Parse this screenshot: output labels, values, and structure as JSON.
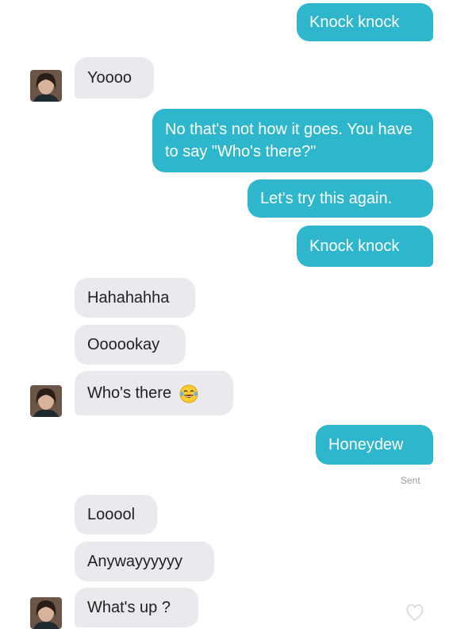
{
  "conversation": {
    "messages": [
      {
        "from": "me",
        "text": "Knock knock"
      },
      {
        "from": "them",
        "text": "Yoooo"
      },
      {
        "from": "me",
        "text": "No that's not how it goes. You have to say \"Who's there?\""
      },
      {
        "from": "me",
        "text": "Let's try this again."
      },
      {
        "from": "me",
        "text": "Knock knock"
      },
      {
        "from": "them",
        "text": "Hahahahha"
      },
      {
        "from": "them",
        "text": "Oooookay"
      },
      {
        "from": "them",
        "text": "Who's there",
        "emoji": "tears-of-joy-emoji"
      },
      {
        "from": "me",
        "text": "Honeydew"
      },
      {
        "from": "them",
        "text": "Looool"
      },
      {
        "from": "them",
        "text": "Anywayyyyyy"
      },
      {
        "from": "them",
        "text": "What's up ?"
      }
    ],
    "delivery_status": "Sent"
  },
  "colors": {
    "sent_bubble": "#2db6cc",
    "received_bubble": "#e9e9ee",
    "sent_text": "#ffffff",
    "received_text": "#222222"
  },
  "icons": {
    "avatar": "contact-avatar",
    "like": "heart-outline-icon"
  }
}
